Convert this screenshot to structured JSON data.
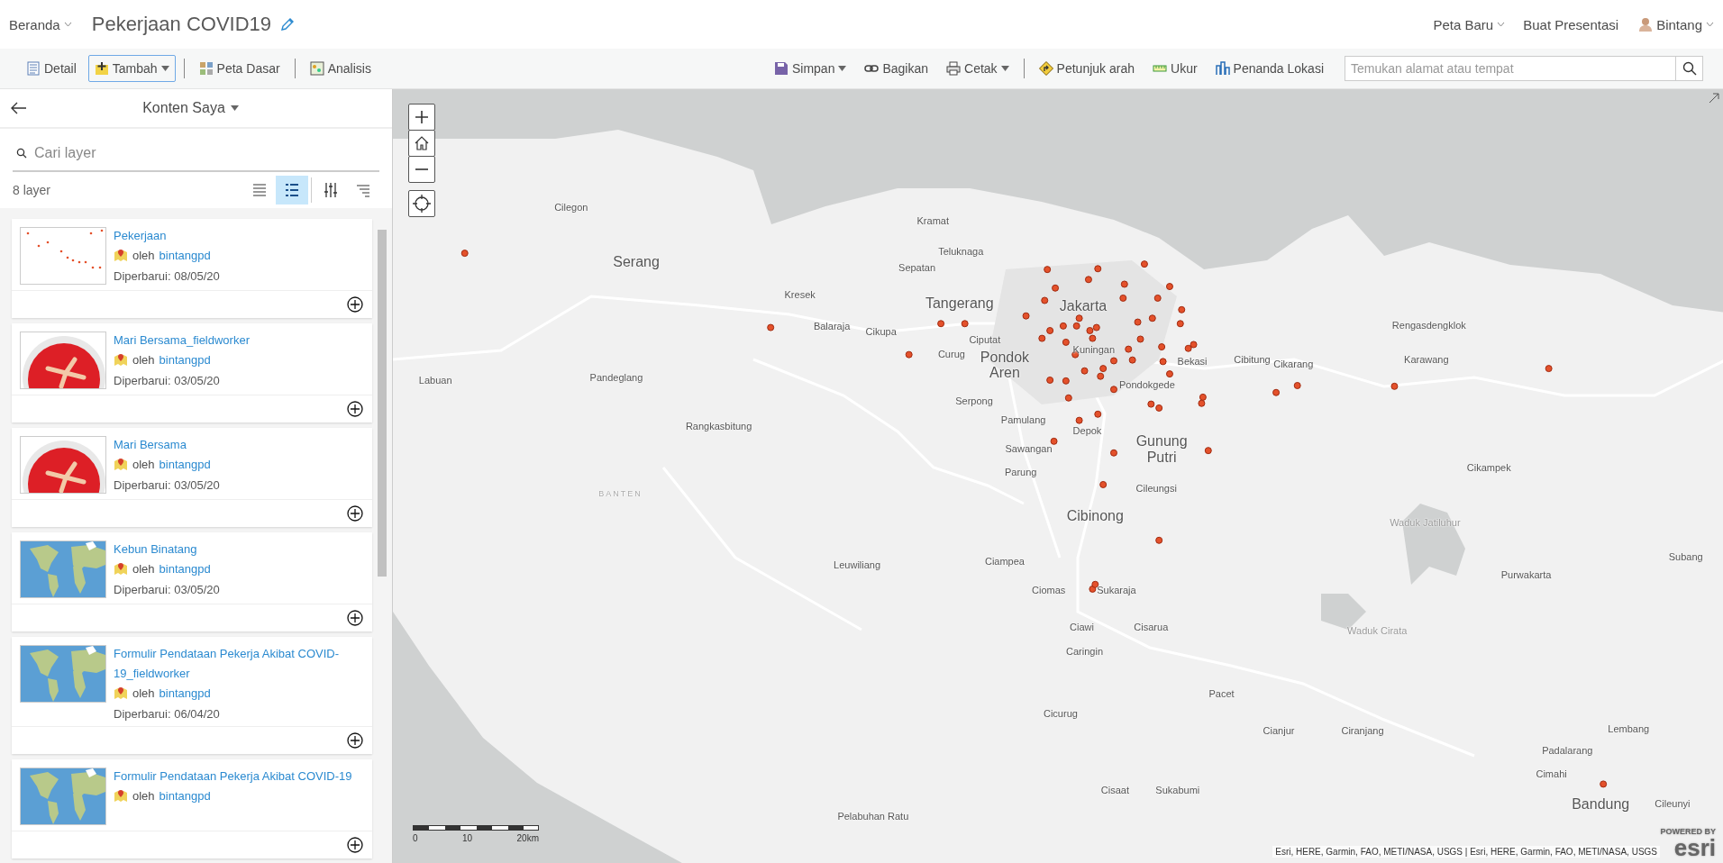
{
  "header": {
    "home": "Beranda",
    "title": "Pekerjaan COVID19",
    "links": [
      {
        "label": "Peta Baru",
        "dropdown": true
      },
      {
        "label": "Buat Presentasi",
        "dropdown": false
      }
    ],
    "user": "Bintang"
  },
  "toolbar": {
    "left": [
      {
        "kind": "details",
        "label": "Detail",
        "selected": false,
        "dropdown": false
      },
      {
        "kind": "add",
        "label": "Tambah",
        "selected": true,
        "dropdown": true
      },
      {
        "kind": "basemap",
        "label": "Peta Dasar",
        "selected": false,
        "dropdown": false
      },
      {
        "kind": "analysis",
        "label": "Analisis",
        "selected": false,
        "dropdown": false
      }
    ],
    "right": [
      {
        "kind": "save",
        "label": "Simpan",
        "dropdown": true
      },
      {
        "kind": "share",
        "label": "Bagikan",
        "dropdown": false
      },
      {
        "kind": "print",
        "label": "Cetak",
        "dropdown": true
      },
      {
        "kind": "directions",
        "label": "Petunjuk arah",
        "dropdown": false
      },
      {
        "kind": "measure",
        "label": "Ukur",
        "dropdown": false
      },
      {
        "kind": "bookmarks",
        "label": "Penanda Lokasi",
        "dropdown": false
      }
    ],
    "search_placeholder": "Temukan alamat atau tempat"
  },
  "panel": {
    "title": "Konten Saya",
    "search_placeholder": "Cari layer",
    "count": "8 layer",
    "view_buttons": [
      {
        "kind": "list",
        "selected": false
      },
      {
        "kind": "detail-list",
        "selected": true
      },
      {
        "kind": "filter",
        "selected": false
      },
      {
        "kind": "sort",
        "selected": false
      }
    ],
    "items": [
      {
        "title": "Pekerjaan",
        "owner_prefix": "oleh",
        "owner": "bintangpd",
        "updated": "Diperbarui: 08/05/20",
        "kind": "points"
      },
      {
        "title": "Mari Bersama_fieldworker",
        "owner_prefix": "oleh",
        "owner": "bintangpd",
        "updated": "Diperbarui: 03/05/20",
        "kind": "logo"
      },
      {
        "title": "Mari Bersama",
        "owner_prefix": "oleh",
        "owner": "bintangpd",
        "updated": "Diperbarui: 03/05/20",
        "kind": "logo"
      },
      {
        "title": "Kebun Binatang",
        "owner_prefix": "oleh",
        "owner": "bintangpd",
        "updated": "Diperbarui: 03/05/20",
        "kind": "world"
      },
      {
        "title": "Formulir Pendataan Pekerja Akibat COVID-19_fieldworker",
        "owner_prefix": "oleh",
        "owner": "bintangpd",
        "updated": "Diperbarui: 06/04/20",
        "kind": "world"
      },
      {
        "title": "Formulir Pendataan Pekerja Akibat COVID-19",
        "owner_prefix": "oleh",
        "owner": "bintangpd",
        "kind": "world"
      }
    ]
  },
  "map": {
    "labels": [
      {
        "text": "Cilegon",
        "kind": "town"
      },
      {
        "text": "Serang",
        "kind": "city"
      },
      {
        "text": "Kramat",
        "kind": "town"
      },
      {
        "text": "Teluknaga",
        "kind": "town"
      },
      {
        "text": "Sepatan",
        "kind": "town"
      },
      {
        "text": "Tangerang",
        "kind": "city"
      },
      {
        "text": "Kresek",
        "kind": "town"
      },
      {
        "text": "Balaraja",
        "kind": "town"
      },
      {
        "text": "Cikupa",
        "kind": "town"
      },
      {
        "text": "Jakarta",
        "kind": "city"
      },
      {
        "text": "Ciputat",
        "kind": "town"
      },
      {
        "text": "Curug",
        "kind": "town"
      },
      {
        "text": "Pondok Aren",
        "kind": "city"
      },
      {
        "text": "Kuningan",
        "kind": "town"
      },
      {
        "text": "Bekasi",
        "kind": "town"
      },
      {
        "text": "Pondokgede",
        "kind": "town"
      },
      {
        "text": "Rengasdengklok",
        "kind": "town"
      },
      {
        "text": "Cibitung",
        "kind": "town"
      },
      {
        "text": "Cikarang",
        "kind": "town"
      },
      {
        "text": "Karawang",
        "kind": "town"
      },
      {
        "text": "Labuan",
        "kind": "town"
      },
      {
        "text": "Pandeglang",
        "kind": "town"
      },
      {
        "text": "Rangkasbitung",
        "kind": "town"
      },
      {
        "text": "Serpong",
        "kind": "town"
      },
      {
        "text": "Pamulang",
        "kind": "town"
      },
      {
        "text": "Depok",
        "kind": "town"
      },
      {
        "text": "Sawangan",
        "kind": "town"
      },
      {
        "text": "Gunung Putri",
        "kind": "city"
      },
      {
        "text": "Parung",
        "kind": "town"
      },
      {
        "text": "Cileungsi",
        "kind": "town"
      },
      {
        "text": "BANTEN",
        "kind": "region"
      },
      {
        "text": "Cibinong",
        "kind": "city"
      },
      {
        "text": "Cikampek",
        "kind": "town"
      },
      {
        "text": "Waduk Jatiluhur",
        "kind": "water"
      },
      {
        "text": "Purwakarta",
        "kind": "town"
      },
      {
        "text": "Subang",
        "kind": "town"
      },
      {
        "text": "Leuwiliang",
        "kind": "town"
      },
      {
        "text": "Ciampea",
        "kind": "town"
      },
      {
        "text": "Ciomas",
        "kind": "town"
      },
      {
        "text": "Sukaraja",
        "kind": "town"
      },
      {
        "text": "Ciawi",
        "kind": "town"
      },
      {
        "text": "Cisarua",
        "kind": "town"
      },
      {
        "text": "Waduk Cirata",
        "kind": "water"
      },
      {
        "text": "Caringin",
        "kind": "town"
      },
      {
        "text": "Pacet",
        "kind": "town"
      },
      {
        "text": "Cicurug",
        "kind": "town"
      },
      {
        "text": "Cianjur",
        "kind": "town"
      },
      {
        "text": "Ciranjang",
        "kind": "town"
      },
      {
        "text": "Lembang",
        "kind": "town"
      },
      {
        "text": "Padalarang",
        "kind": "town"
      },
      {
        "text": "Cimahi",
        "kind": "town"
      },
      {
        "text": "Cisaat",
        "kind": "town"
      },
      {
        "text": "Sukabumi",
        "kind": "town"
      },
      {
        "text": "Bandung",
        "kind": "city"
      },
      {
        "text": "Cileunyi",
        "kind": "town"
      },
      {
        "text": "Pelabuhan Ratu",
        "kind": "town"
      }
    ],
    "scale": [
      "0",
      "10",
      "20km"
    ],
    "attribution": "Esri, HERE, Garmin, FAO, METI/NASA, USGS | Esri, HERE, Garmin, FAO, METI/NASA, USGS",
    "logo_caption": "POWERED BY",
    "logo": "esri"
  }
}
